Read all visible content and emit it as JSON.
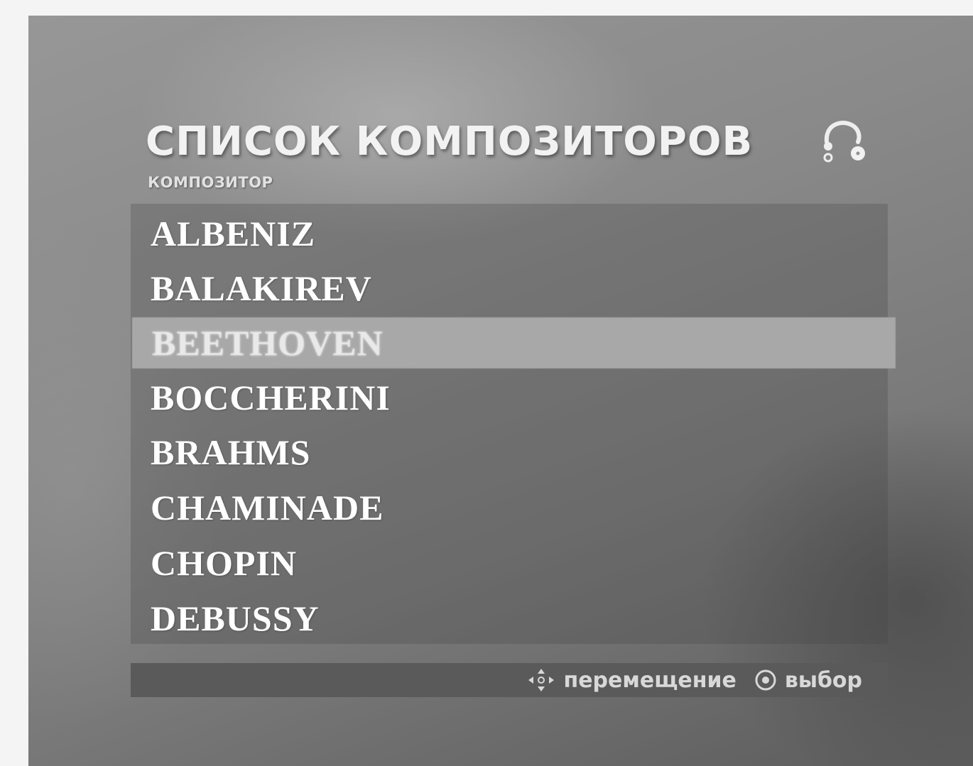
{
  "header": {
    "title": "СПИСОК КОМПОЗИТОРОВ",
    "subtitle": "КОМПОЗИТОР",
    "icon": "disc-menu-icon"
  },
  "composers": {
    "items": [
      "ALBENIZ",
      "BALAKIREV",
      "BEETHOVEN",
      "BOCCHERINI",
      "BRAHMS",
      "CHAMINADE",
      "CHOPIN",
      "DEBUSSY"
    ],
    "selected_index": 2
  },
  "footer": {
    "move_icon": "navigation-arrows-icon",
    "move_label": "перемещение",
    "select_icon": "enter-button-icon",
    "select_label": "выбор"
  },
  "colors": {
    "highlight": "#a8a8a8",
    "footer_bar": "#5a5a5a",
    "text": "#ffffff"
  }
}
